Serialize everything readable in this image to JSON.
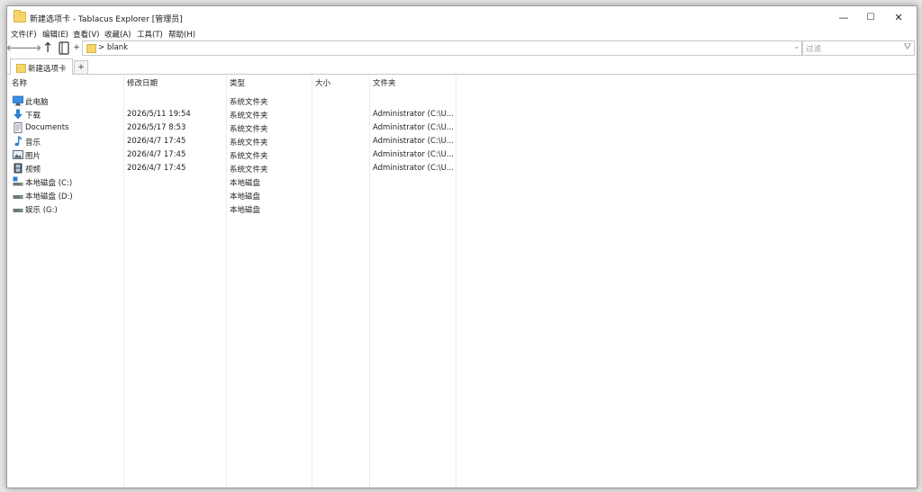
{
  "window": {
    "title": "新建选项卡 - Tablacus Explorer [管理员]",
    "minimize": "—",
    "maximize": "☐",
    "close": "✕"
  },
  "menu": [
    "文件(F)",
    "编辑(E)",
    "查看(V)",
    "收藏(A)",
    "工具(T)",
    "帮助(H)"
  ],
  "toolbar": {
    "back": "⟵",
    "forward": "⟶",
    "up": "↑",
    "plus": "+",
    "address": "> blank",
    "dropdown": "⌄",
    "search_placeholder": "过滤",
    "filter": "⛛"
  },
  "tabs": {
    "active": "新建选项卡",
    "add": "+"
  },
  "columns": [
    "名称",
    "修改日期",
    "类型",
    "大小",
    "文件夹"
  ],
  "rows": [
    {
      "icon": "computer-icon",
      "name": "此电脑",
      "date": "",
      "type": "系统文件夹",
      "size": "",
      "folder": ""
    },
    {
      "icon": "download-icon",
      "name": "下载",
      "date": "2026/5/11 19:54",
      "type": "系统文件夹",
      "size": "",
      "folder": "Administrator (C:\\U..."
    },
    {
      "icon": "document-icon",
      "name": "Documents",
      "date": "2026/5/17 8:53",
      "type": "系统文件夹",
      "size": "",
      "folder": "Administrator (C:\\U..."
    },
    {
      "icon": "music-icon",
      "name": "音乐",
      "date": "2026/4/7 17:45",
      "type": "系统文件夹",
      "size": "",
      "folder": "Administrator (C:\\U..."
    },
    {
      "icon": "picture-icon",
      "name": "图片",
      "date": "2026/4/7 17:45",
      "type": "系统文件夹",
      "size": "",
      "folder": "Administrator (C:\\U..."
    },
    {
      "icon": "video-icon",
      "name": "视频",
      "date": "2026/4/7 17:45",
      "type": "系统文件夹",
      "size": "",
      "folder": "Administrator (C:\\U..."
    },
    {
      "icon": "drive-system-icon",
      "name": "本地磁盘 (C:)",
      "date": "",
      "type": "本地磁盘",
      "size": "",
      "folder": ""
    },
    {
      "icon": "drive-icon",
      "name": "本地磁盘 (D:)",
      "date": "",
      "type": "本地磁盘",
      "size": "",
      "folder": ""
    },
    {
      "icon": "drive-icon",
      "name": "娱乐 (G:)",
      "date": "",
      "type": "本地磁盘",
      "size": "",
      "folder": ""
    }
  ]
}
